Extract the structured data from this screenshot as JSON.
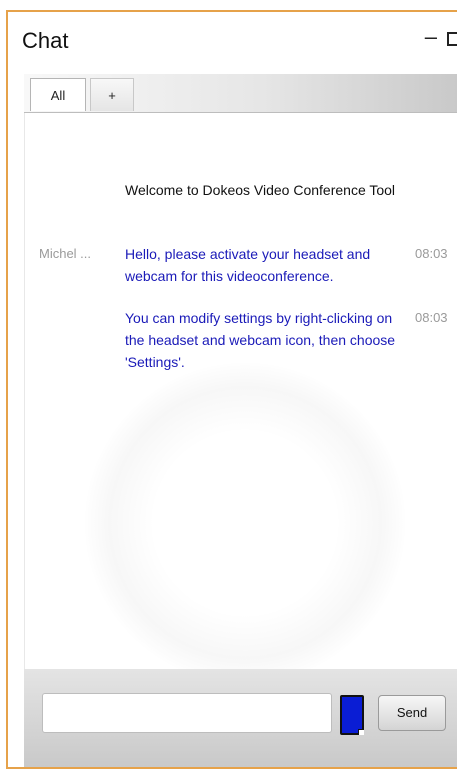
{
  "window": {
    "title": "Chat"
  },
  "tabs": [
    {
      "label": "All"
    },
    {
      "label": "+"
    }
  ],
  "messages": [
    {
      "sender": "",
      "text": "Welcome to Dokeos Video Conference Tool",
      "time": "",
      "color": "#111111"
    },
    {
      "sender": "Michel ...",
      "text": "Hello, please activate your headset and webcam for this videoconference.",
      "time": "08:03",
      "color": "#1a1ab8"
    },
    {
      "sender": "",
      "text": "You can modify settings by right-clicking on the headset and webcam icon, then choose 'Settings'.",
      "time": "08:03",
      "color": "#1a1ab8"
    }
  ],
  "composer": {
    "input_value": "",
    "swatch_color": "#0a1dd4",
    "send_label": "Send"
  },
  "colors": {
    "border": "#e6a24a",
    "message_text": "#1a1ab8",
    "meta_text": "#9a9a9a"
  }
}
